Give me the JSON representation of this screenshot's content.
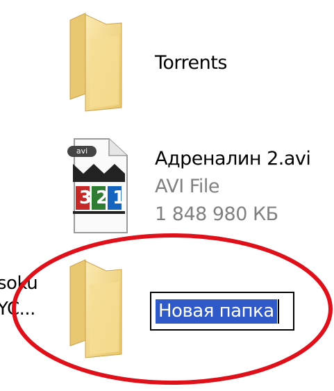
{
  "items": [
    {
      "name": "Torrents",
      "type": "folder"
    },
    {
      "name": "Адреналин 2.avi",
      "type_label": "AVI File",
      "size": "1 848 980 КБ",
      "badge": "avi",
      "counter": "321"
    },
    {
      "name_value": "Новая папка",
      "state": "renaming"
    }
  ],
  "left_clipped": {
    "line1": "soku",
    "line2": "YC..."
  },
  "colors": {
    "selection": "#2f58c8",
    "annotation": "#e0101a",
    "folder": "#f3d98a"
  }
}
